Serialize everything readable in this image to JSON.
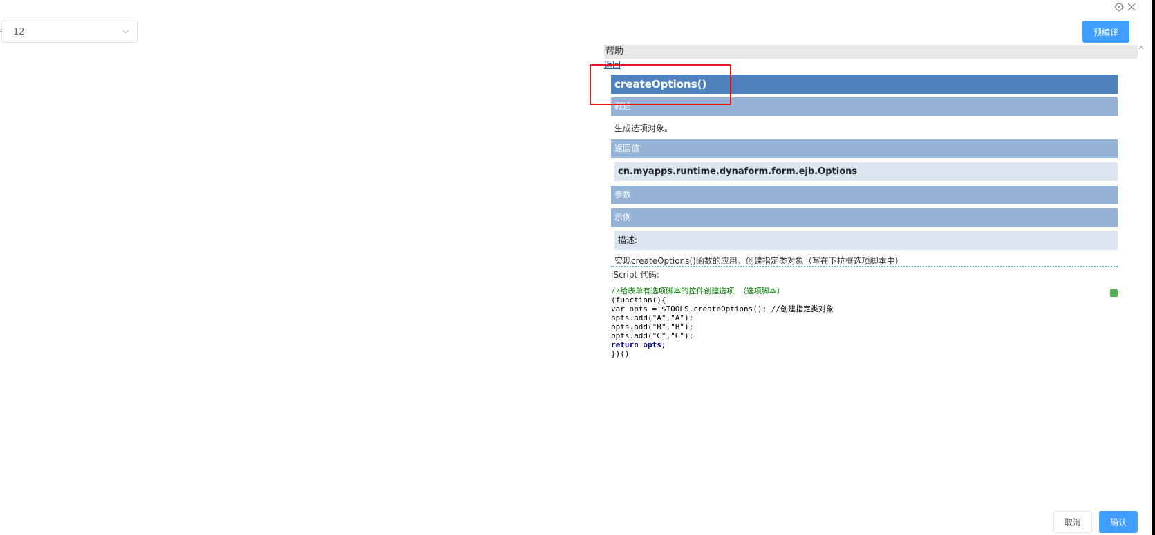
{
  "select": {
    "value": "12"
  },
  "toolbar": {
    "precompile_label": "预编译"
  },
  "help": {
    "header": "帮助",
    "back_link": "返回",
    "function_title": "createOptions()",
    "overview_label": "概述",
    "overview_text": "生成选项对象。",
    "return_label": "返回值",
    "return_type": "cn.myapps.runtime.dynaform.form.ejb.Options",
    "params_label": "参数",
    "example_label": "示例",
    "example_desc_label": "描述:",
    "example_desc_text": "实现createOptions()函数的应用，创建指定类对象（写在下拉框选项脚本中）",
    "code_label": "iScript 代码:",
    "code_lines": [
      "//给表单有选项脚本的控件创建选项 （选项脚本）",
      "(function(){",
      "var opts = $TOOLS.createOptions(); //创建指定类对象",
      "opts.add(\"A\",\"A\");",
      "opts.add(\"B\",\"B\");",
      "opts.add(\"C\",\"C\");",
      "return opts;",
      "})()"
    ]
  },
  "footer": {
    "cancel_label": "取消",
    "confirm_label": "确认"
  },
  "colors": {
    "primary": "#409eff",
    "section_title": "#4f81bd",
    "section_bar": "#95b3d7",
    "sub_box": "#dce6f1",
    "highlight_box": "#e21a1a"
  },
  "icons": [
    "chevron-down-icon",
    "target-icon",
    "close-icon",
    "copy-code-icon"
  ]
}
